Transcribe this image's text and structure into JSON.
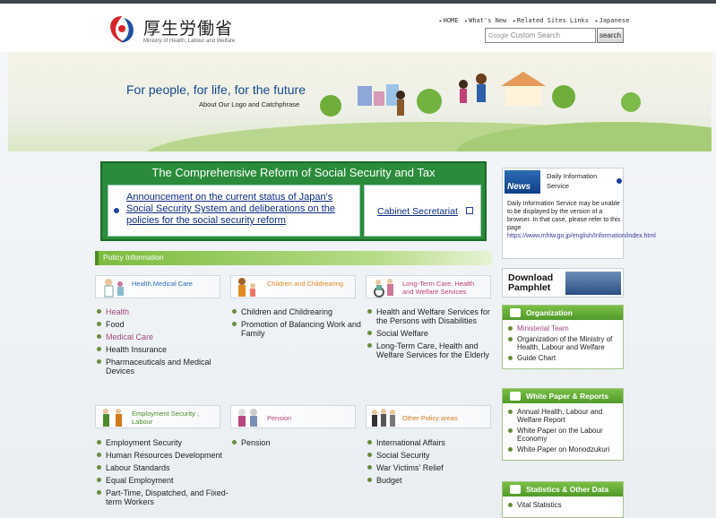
{
  "header": {
    "logo_jp": "厚生労働省",
    "logo_en": "Ministry of Health, Labour and Welfare",
    "nav": [
      "HOME",
      "What's New",
      "Related Sites Links",
      "Japanese"
    ],
    "search_placeholder_brand": "Google",
    "search_placeholder": "Custom Search",
    "search_button": "search"
  },
  "hero": {
    "title": "For people, for life, for the future",
    "subtitle": "About Our Logo and Catchphrase"
  },
  "reform": {
    "title": "The Comprehensive Reform of Social Security and Tax",
    "link_main": "Announcement on the current status of Japan's Social Security System and deliberations on the policies for the social security reform",
    "link_cabinet": "Cabinet Secretariat"
  },
  "policy": {
    "header": "Policy Information",
    "categories": [
      {
        "label": "Health,Medical Care",
        "color": "#2b6fb8",
        "items": [
          {
            "t": "Health",
            "hl": true
          },
          {
            "t": "Food",
            "hl": false
          },
          {
            "t": "Medical Care",
            "hl": true
          },
          {
            "t": "Health Insurance",
            "hl": false
          },
          {
            "t": "Pharmaceuticals and Medical Devices",
            "hl": false
          }
        ]
      },
      {
        "label": "Children and Childrearing",
        "color": "#e08a1f",
        "items": [
          {
            "t": "Children and Childrearing",
            "hl": false
          },
          {
            "t": "Promotion of Balancing Work and Family",
            "hl": false
          }
        ]
      },
      {
        "label": "Long-Term Care, Health and Welfare Services",
        "color": "#c0407a",
        "items": [
          {
            "t": "Health and Welfare Services for the Persons with Disabilities",
            "hl": false
          },
          {
            "t": "Social Welfare",
            "hl": false
          },
          {
            "t": "Long-Term Care, Health and Welfare Services for the Elderly",
            "hl": false
          }
        ]
      },
      {
        "label": "Employment Security , Labour",
        "color": "#4a8c2a",
        "items": [
          {
            "t": "Employment Security",
            "hl": false
          },
          {
            "t": "Human Resources Development",
            "hl": false
          },
          {
            "t": "Labour Standards",
            "hl": false
          },
          {
            "t": "Equal Employment",
            "hl": false
          },
          {
            "t": "Part-Time, Dispatched, and Fixed-term Workers",
            "hl": false
          }
        ]
      },
      {
        "label": "Pension",
        "color": "#b8467e",
        "items": [
          {
            "t": "Pension",
            "hl": false
          }
        ]
      },
      {
        "label": "Other Policy areas",
        "color": "#d07a1a",
        "items": [
          {
            "t": "International Affairs",
            "hl": false
          },
          {
            "t": "Social Security",
            "hl": false
          },
          {
            "t": "War Victims' Relief",
            "hl": false
          },
          {
            "t": "Budget",
            "hl": false
          }
        ]
      }
    ]
  },
  "news": {
    "badge": "News",
    "title": "Daily Information Service",
    "body": "Daily Information Service may be unable to be displayed by the version of a browser. In that case, please refer to this page",
    "url": "https://www.mhlw.go.jp/english/Information/index.html"
  },
  "download": {
    "label": "Download Pamphlet"
  },
  "organization": {
    "header": "Organization",
    "items": [
      {
        "t": "Ministerial Team",
        "hl": true
      },
      {
        "t": "Organization of the Ministry of Health, Labour and Welfare",
        "hl": false
      },
      {
        "t": "Guide Chart",
        "hl": false
      }
    ]
  },
  "whitepaper": {
    "header": "White Paper & Reports",
    "items": [
      {
        "t": "Annual Health, Labour and Welfare Report",
        "hl": false
      },
      {
        "t": "White Paper on the Labour Economy",
        "hl": false
      },
      {
        "t": "White Paper on Monodzukuri",
        "hl": false
      }
    ]
  },
  "statistics": {
    "header": "Statistics & Other Data",
    "items": [
      {
        "t": "Vital Statistics",
        "hl": false
      }
    ]
  }
}
